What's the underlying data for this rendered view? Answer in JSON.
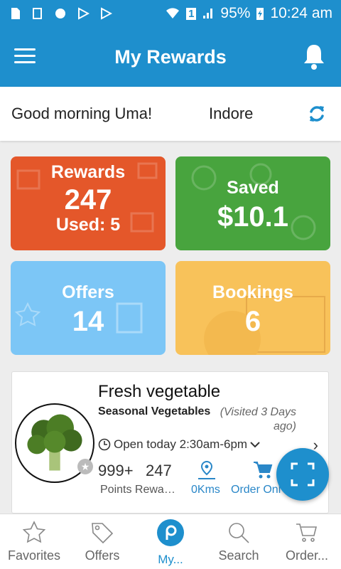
{
  "status": {
    "battery": "95%",
    "time": "10:24 am",
    "sim": "1"
  },
  "appbar": {
    "title": "My Rewards"
  },
  "greeting": {
    "text": "Good morning Uma!",
    "city": "Indore"
  },
  "tiles": {
    "rewards": {
      "title": "Rewards",
      "value": "247",
      "sub": "Used: 5"
    },
    "saved": {
      "title": "Saved",
      "value": "$10.1"
    },
    "offers": {
      "title": "Offers",
      "value": "14"
    },
    "bookings": {
      "title": "Bookings",
      "value": "6"
    }
  },
  "store": {
    "name": "Fresh vegetable",
    "category": "Seasonal Vegetables",
    "visited": "(Visited 3 Days ago)",
    "hours": "Open today 2:30am-6pm",
    "points": "999+",
    "reward": "247",
    "points_label": "Points Rewa…",
    "distance": "0Kms",
    "order_label": "Order Onl"
  },
  "bottomnav": {
    "favorites": "Favorites",
    "offers": "Offers",
    "my": "My...",
    "search": "Search",
    "order": "Order..."
  },
  "colors": {
    "primary": "#1e8fcd",
    "rewards": "#e4572a",
    "saved": "#48a43e",
    "offers": "#7cc6f6",
    "bookings": "#f8c25a"
  }
}
